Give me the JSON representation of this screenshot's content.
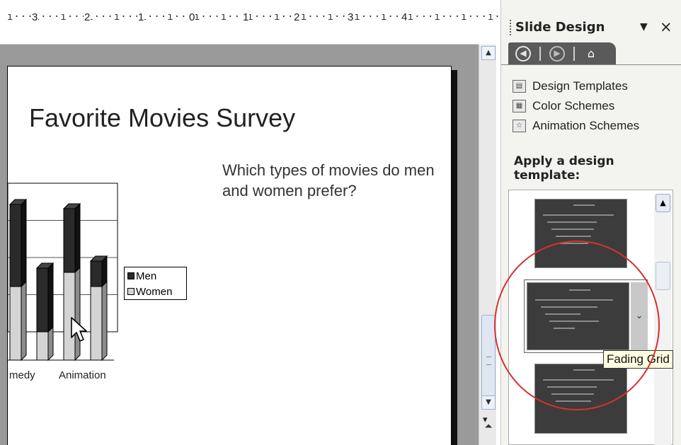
{
  "ruler": {
    "numbers": [
      "3",
      "2",
      "1",
      "0",
      "1",
      "2",
      "3",
      "4"
    ],
    "ticks": "ı···ı···ı···ı···ı···ı···ı···ı···ı···ı···ı···ı···ı···ı···ı···ı···ı···ı···ı···ı···ı···ı···ı···ı···"
  },
  "slide": {
    "title": "Favorite Movies Survey",
    "body": "Which types of movies do men and women prefer?"
  },
  "chart_data": {
    "type": "bar",
    "stacked": true,
    "categories": [
      "",
      "",
      "",
      ""
    ],
    "tick_labels": [
      "medy",
      "Animation"
    ],
    "series": [
      {
        "name": "Men",
        "values": [
          58,
          45,
          45,
          18
        ]
      },
      {
        "name": "Women",
        "values": [
          52,
          20,
          62,
          52
        ]
      }
    ],
    "colors": {
      "Men": "#2a2a2a",
      "Women": "#d4d4d4"
    },
    "legend_position": "right",
    "grid": true
  },
  "task_pane": {
    "title": "Slide Design",
    "menu_icon": "▼",
    "close_icon": "×",
    "nav": {
      "back_icon": "back-arrow-icon",
      "forward_icon": "forward-arrow-icon",
      "home_icon": "home-icon"
    },
    "links": [
      {
        "label": "Design Templates",
        "icon": "design-templates-icon"
      },
      {
        "label": "Color Schemes",
        "icon": "color-schemes-icon"
      },
      {
        "label": "Animation Schemes",
        "icon": "animation-schemes-icon"
      }
    ],
    "apply_label": "Apply a design template:",
    "tooltip": "Fading Grid",
    "highlight_color": "#d63030"
  }
}
